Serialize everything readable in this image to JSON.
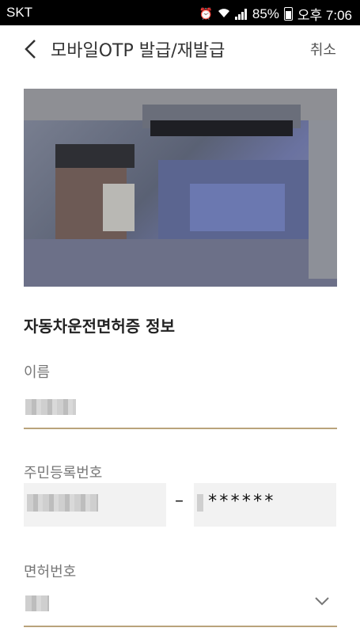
{
  "status_bar": {
    "carrier": "SKT",
    "battery": "85%",
    "time": "오후 7:06"
  },
  "header": {
    "title": "모바일OTP 발급/재발급",
    "cancel_label": "취소"
  },
  "section": {
    "title": "자동차운전면허증 정보"
  },
  "fields": {
    "name_label": "이름",
    "rrn_label": "주민등록번호",
    "rrn_separator": "–",
    "rrn_masked": "******",
    "license_label": "면허번호"
  },
  "colors": {
    "accent_underline": "#b9a37b",
    "field_bg": "#f2f2f2"
  }
}
